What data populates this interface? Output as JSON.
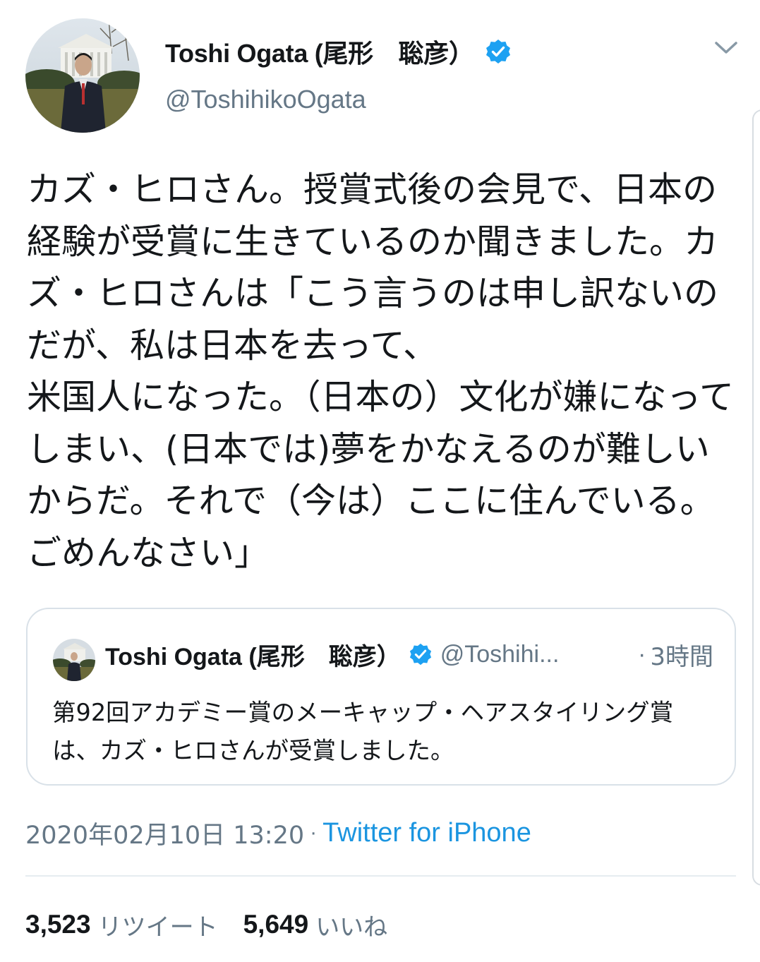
{
  "author": {
    "display_name": "Toshi Ogata (尾形　聡彦）",
    "handle": "@ToshihikoOgata",
    "verified": true
  },
  "tweet": {
    "text": "カズ・ヒロさん。授賞式後の会見で、日本の経験が受賞に生きているのか聞きました。カズ・ヒロさんは「こう言うのは申し訳ないのだが、私は日本を去って、\n米国人になった。（日本の）文化が嫌になってしまい、(日本では)夢をかなえるのが難しいからだ。それで（今は）ここに住んでいる。ごめんなさい」"
  },
  "quoted_tweet": {
    "display_name": "Toshi Ogata (尾形　聡彦）",
    "handle": "@Toshihi...",
    "separator": "·",
    "time": "3時間",
    "text": "第92回アカデミー賞のメーキャップ・ヘアスタイリング賞は、カズ・ヒロさんが受賞しました。"
  },
  "meta": {
    "timestamp": "2020年02月10日 13:20",
    "separator": "·",
    "source": "Twitter for iPhone"
  },
  "stats": {
    "retweets_count": "3,523",
    "retweets_label": "リツイート",
    "likes_count": "5,649",
    "likes_label": "いいね"
  },
  "colors": {
    "text_primary": "#14171a",
    "text_secondary": "#657786",
    "link": "#1b95e0",
    "verified_badge": "#1da1f2",
    "border": "#d9e1e8"
  },
  "icons": {
    "verified": "verified-badge-icon",
    "menu": "chevron-down-icon"
  }
}
